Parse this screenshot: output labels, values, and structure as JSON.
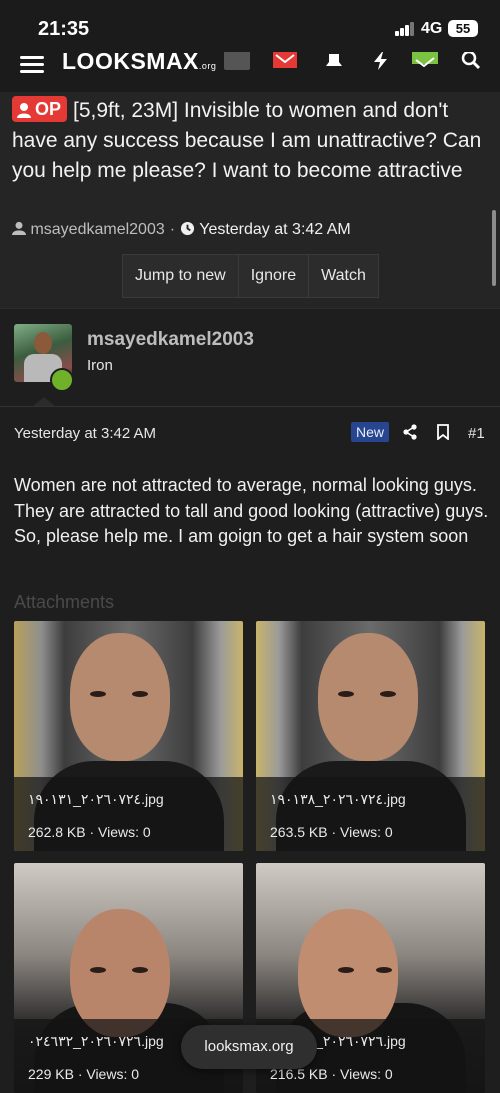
{
  "status_bar": {
    "time": "21:35",
    "network": "4G",
    "battery": "55"
  },
  "app_bar": {
    "logo_main": "LOOKSMAX",
    "logo_suffix": ".org"
  },
  "thread": {
    "op_badge": "OP",
    "title": "[5,9ft, 23M] Invisible to women and don't have any success because I am unattractive? Can you help me please? I want to become attractive",
    "author": "msayedkamel2003",
    "date": "Yesterday at 3:42 AM",
    "actions": [
      "Jump to new",
      "Ignore",
      "Watch"
    ]
  },
  "post": {
    "username": "msayedkamel2003",
    "rank": "Iron",
    "date": "Yesterday at 3:42 AM",
    "new_badge": "New",
    "post_number": "#1",
    "body": "Women are not attracted to average, normal looking guys. They are attracted to tall and good looking (attractive) guys. So, please help me. I am goign to get a hair system soon",
    "attachments_label": "Attachments",
    "attachments": [
      {
        "filename": "٢٠٢٦٠٧٢٤_١٩٠١٣١.jpg",
        "meta": "262.8 KB · Views: 0"
      },
      {
        "filename": "٢٠٢٦٠٧٢٤_١٩٠١٣٨.jpg",
        "meta": "263.5 KB · Views: 0"
      },
      {
        "filename": "٢٠٢٦٠٧٢٦_٠٢٤٦٣٢.jpg",
        "meta": "229 KB · Views: 0"
      },
      {
        "filename": "٢٠٢٦٠٧٢٦_٠٢٤٦٣٥.jpg",
        "meta": "216.5 KB · Views: 0"
      }
    ]
  },
  "toast": {
    "label": "looksmax.org"
  }
}
